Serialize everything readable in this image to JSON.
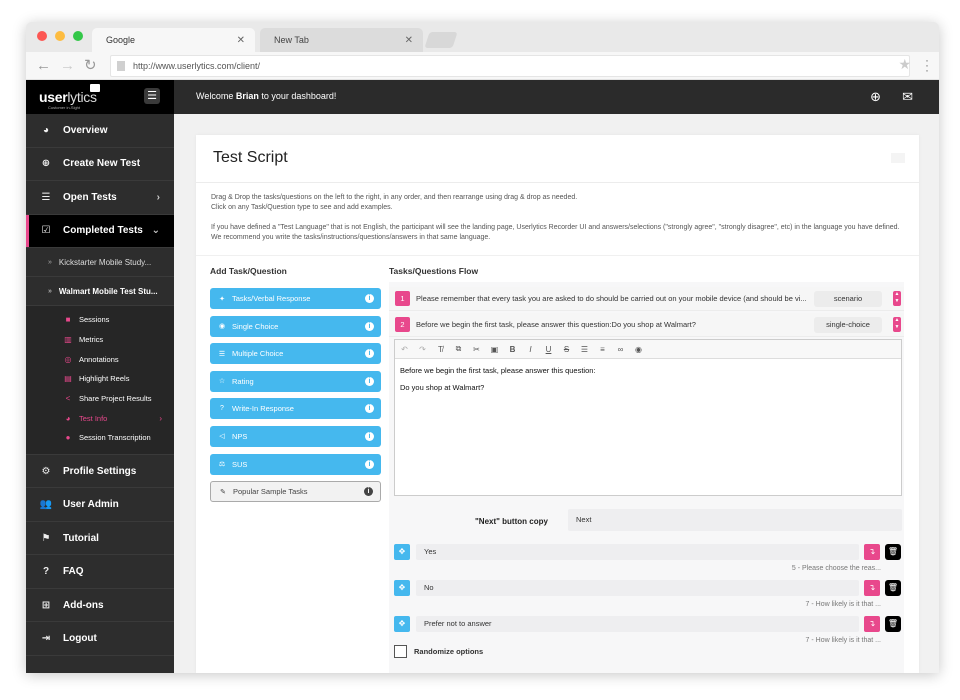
{
  "browser": {
    "tabs": [
      {
        "label": "Google",
        "active": true
      },
      {
        "label": "New Tab",
        "active": false
      }
    ],
    "url": "http://www.userlytics.com/client/",
    "traffic_lights": [
      "#fc5753",
      "#fdbc40",
      "#33c748"
    ]
  },
  "brand": {
    "logo_bold": "user",
    "logo_light": "lytics",
    "tagline": "Customer in-Sight"
  },
  "topbar": {
    "welcome_prefix": "Welcome ",
    "user_name": "Brian",
    "welcome_suffix": " to your dashboard!"
  },
  "sidebar": {
    "items": [
      {
        "label": "Overview",
        "icon": "dashboard-icon"
      },
      {
        "label": "Create New Test",
        "icon": "plus-circle-icon"
      },
      {
        "label": "Open Tests",
        "icon": "list-icon",
        "chevron": ">"
      },
      {
        "label": "Completed Tests",
        "icon": "check-square-icon",
        "chevron": "v",
        "active": true
      }
    ],
    "studies": [
      {
        "label": "Kickstarter Mobile Study...",
        "expanded": false
      },
      {
        "label": "Walmart Mobile Test Stu...",
        "expanded": true
      }
    ],
    "study_links": [
      {
        "label": "Sessions",
        "icon": "video-camera-icon"
      },
      {
        "label": "Metrics",
        "icon": "bar-chart-icon"
      },
      {
        "label": "Annotations",
        "icon": "target-icon"
      },
      {
        "label": "Highlight Reels",
        "icon": "film-icon"
      },
      {
        "label": "Share Project Results",
        "icon": "share-icon"
      },
      {
        "label": "Test Info",
        "icon": "dashboard-icon",
        "active": true
      },
      {
        "label": "Session Transcription",
        "icon": "comment-icon"
      }
    ],
    "bottom_items": [
      {
        "label": "Profile Settings",
        "icon": "gears-icon"
      },
      {
        "label": "User Admin",
        "icon": "users-icon"
      },
      {
        "label": "Tutorial",
        "icon": "flag-icon"
      },
      {
        "label": "FAQ",
        "icon": "question-circle-icon"
      },
      {
        "label": "Add-ons",
        "icon": "plus-square-icon"
      },
      {
        "label": "Logout",
        "icon": "sign-in-icon"
      }
    ]
  },
  "card": {
    "title": "Test Script",
    "intro": [
      "Drag & Drop the tasks/questions on the left to the right, in any order, and then rearrange using drag & drop as needed.",
      "Click on any Task/Question type to see and add examples.",
      "If you have defined a \"Test Language\" that is not English, the participant will see the landing page, Userlytics Recorder UI and answers/selections (\"strongly agree\", \"strongly disagree\", etc) in the language you have defined. We recommend you write the tasks/instructions/questions/answers in that same language."
    ]
  },
  "palette": {
    "title": "Add Task/Question",
    "items": [
      {
        "label": "Tasks/Verbal Response",
        "icon": "thumbtack-icon"
      },
      {
        "label": "Single Choice",
        "icon": "dot-circle-icon"
      },
      {
        "label": "Multiple Choice",
        "icon": "list-icon"
      },
      {
        "label": "Rating",
        "icon": "star-icon"
      },
      {
        "label": "Write-In Response",
        "icon": "question-circle-icon"
      },
      {
        "label": "NPS",
        "icon": "bullhorn-icon"
      },
      {
        "label": "SUS",
        "icon": "balance-scale-icon"
      },
      {
        "label": "Popular Sample Tasks",
        "icon": "pen-icon"
      }
    ]
  },
  "flow": {
    "title": "Tasks/Questions Flow",
    "rows": [
      {
        "num": "1",
        "text": "Please remember that every task you are asked to do should be carried out on your mobile device (and should be vi...",
        "type": "scenario"
      },
      {
        "num": "2",
        "text": "Before we begin the first task, please answer this question:Do you shop at Walmart?",
        "type": "single-choice"
      }
    ],
    "editor": {
      "toolbar": [
        "undo",
        "redo",
        "clear-format",
        "copy",
        "cut",
        "paste",
        "bold",
        "italic",
        "underline",
        "strikethrough",
        "bullet-list",
        "numbered-list",
        "link",
        "preview"
      ],
      "lines": [
        "Before we begin the first task, please answer this question:",
        "Do you shop at Walmart?"
      ]
    },
    "next_label": "\"Next\" button copy",
    "next_value": "Next",
    "options": [
      {
        "label": "Yes",
        "skip": "5 - Please choose the reas..."
      },
      {
        "label": "No",
        "skip": "7 - How likely is it that ..."
      },
      {
        "label": "Prefer not to answer",
        "skip": "7 - How likely is it that ..."
      }
    ],
    "randomize_label": "Randomize options",
    "randomize_checked": false
  },
  "colors": {
    "accent_pink": "#e8488c",
    "accent_blue": "#45b8ee",
    "sidebar_bg": "#2d2d2d",
    "topbar_bg": "#2b2b2b"
  }
}
